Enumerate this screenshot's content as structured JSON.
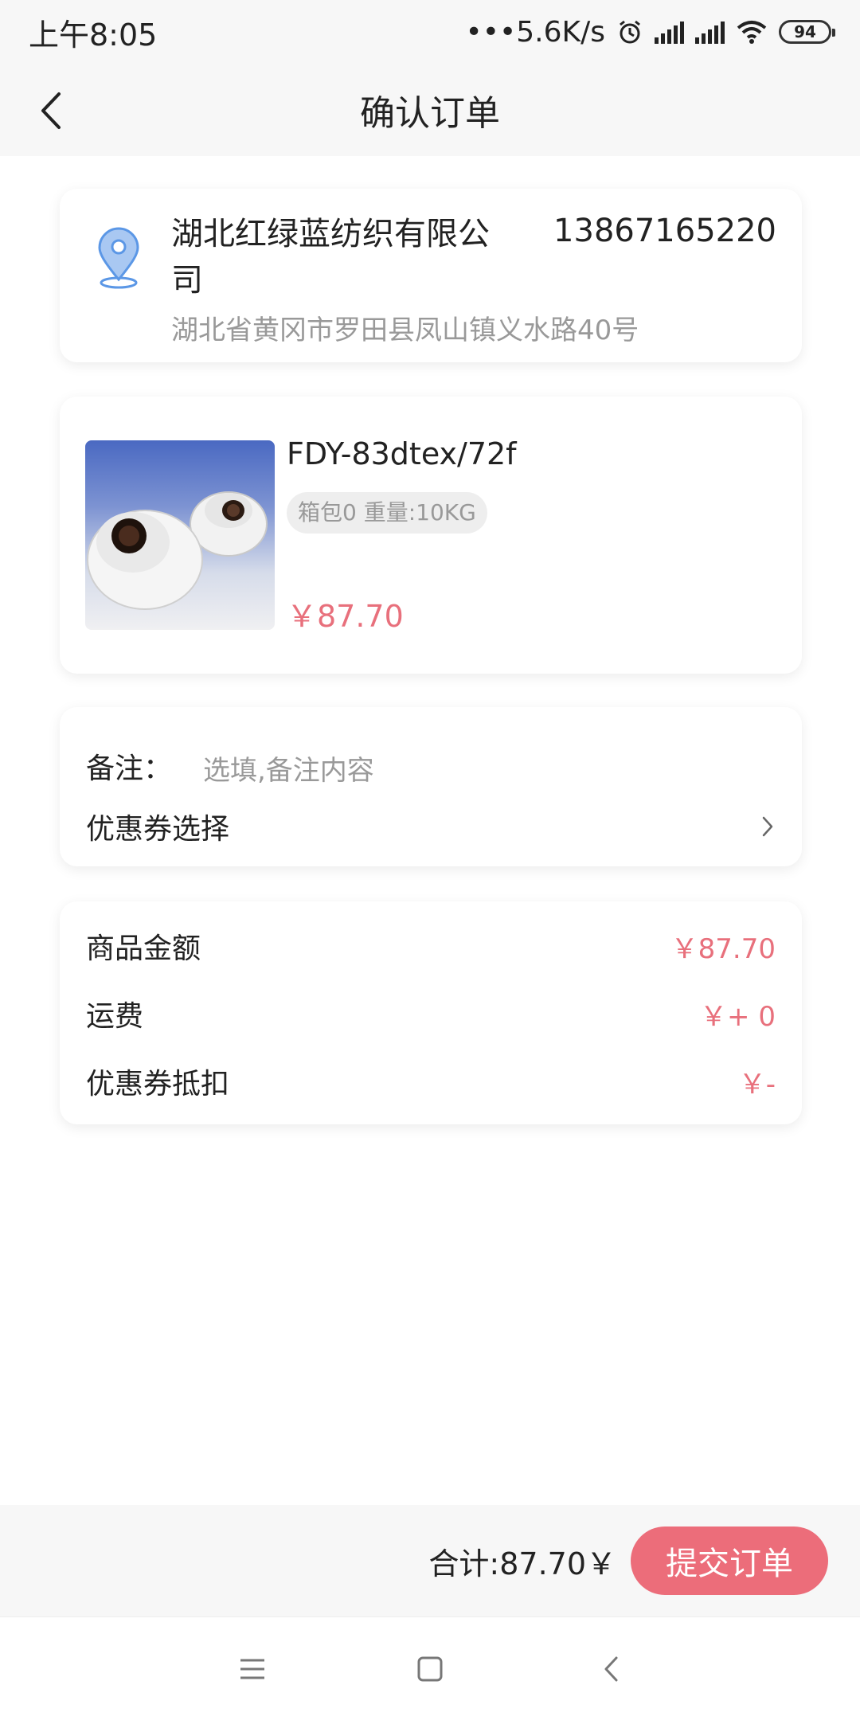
{
  "status_bar": {
    "time": "上午8:05",
    "network_speed": "•••5.6K/s",
    "battery_level": "94"
  },
  "nav": {
    "title": "确认订单",
    "back_icon": "chevron-left-icon"
  },
  "address": {
    "company": "湖北红绿蓝纺织有限公司",
    "phone": "13867165220",
    "detail": "湖北省黄冈市罗田县凤山镇义水路40号",
    "icon": "location-pin-icon",
    "icon_color": "#5b97e6"
  },
  "product": {
    "name": "FDY-83dtex/72f",
    "tag": "箱包0 重量:10KG",
    "price": "￥87.70"
  },
  "remark": {
    "label": "备注：",
    "placeholder": "选填,备注内容",
    "value": ""
  },
  "coupon": {
    "label": "优惠券选择"
  },
  "summary": {
    "rows": [
      {
        "label": "商品金额",
        "value": "￥87.70"
      },
      {
        "label": "运费",
        "value": "￥+ 0"
      },
      {
        "label": "优惠券抵扣",
        "value": "￥-"
      }
    ]
  },
  "footer": {
    "total": "合计:87.70￥",
    "submit_label": "提交订单"
  },
  "colors": {
    "accent": "#ec6d7a",
    "price": "#e8707c",
    "secondary_text": "#999999"
  }
}
